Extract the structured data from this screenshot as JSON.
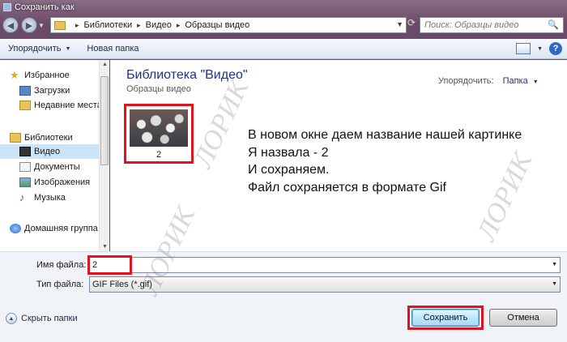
{
  "window": {
    "title": "Сохранить как"
  },
  "address": {
    "crumbs": [
      "Библиотеки",
      "Видео",
      "Образцы видео"
    ],
    "search_placeholder": "Поиск: Образцы видео"
  },
  "toolbar": {
    "organize": "Упорядочить",
    "new_folder": "Новая папка",
    "help": "?"
  },
  "nav": {
    "favorites_header": "Избранное",
    "favorites": [
      "Загрузки",
      "Недавние места"
    ],
    "libraries_header": "Библиотеки",
    "libraries": [
      "Видео",
      "Документы",
      "Изображения",
      "Музыка"
    ],
    "homegroup": "Домашняя группа",
    "selected": "Видео"
  },
  "content": {
    "library_title": "Библиотека \"Видео\"",
    "library_subtitle": "Образцы видео",
    "arrange_label": "Упорядочить:",
    "arrange_value": "Папка",
    "items": [
      {
        "label": "2"
      }
    ]
  },
  "annotation": [
    "В новом окне даем название нашей картинке",
    "Я назвала - 2",
    "И сохраняем.",
    "Файл сохраняется в формате Gif"
  ],
  "watermark": "ЛОРИК",
  "form": {
    "filename_label": "Имя файла:",
    "filename_value": "2",
    "filetype_label": "Тип файла:",
    "filetype_value": "GIF Files (*.gif)"
  },
  "footer": {
    "hide_folders": "Скрыть папки",
    "save": "Сохранить",
    "cancel": "Отмена"
  },
  "colors": {
    "highlight_box": "#e0141e",
    "selection": "#cce4f7",
    "link": "#1e3287"
  }
}
